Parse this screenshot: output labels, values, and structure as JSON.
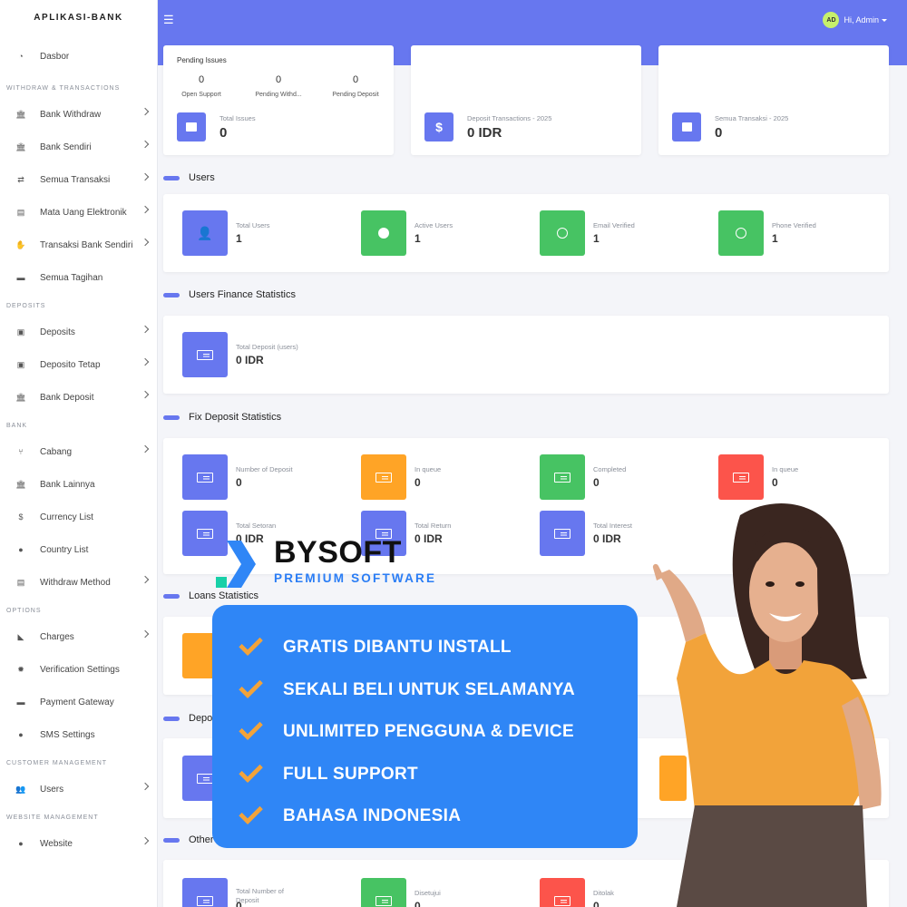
{
  "sidebar": {
    "brand": "APLIKASI-BANK",
    "dashboard": "Dasbor",
    "sections": {
      "withdraw": "WITHDRAW & TRANSACTIONS",
      "deposits": "DEPOSITS",
      "bank": "BANK",
      "options": "OPTIONS",
      "customer": "CUSTOMER MANAGEMENT",
      "website": "WEBSITE MANAGEMENT"
    },
    "items": {
      "bank_withdraw": "Bank Withdraw",
      "bank_sendiri": "Bank Sendiri",
      "semua_transaksi": "Semua Transaksi",
      "mata_uang": "Mata Uang Elektronik",
      "transaksi_bank": "Transaksi Bank Sendiri",
      "semua_tagihan": "Semua Tagihan",
      "deposits": "Deposits",
      "deposito_tetap": "Deposito Tetap",
      "bank_deposit": "Bank Deposit",
      "cabang": "Cabang",
      "bank_lainnya": "Bank Lainnya",
      "currency_list": "Currency List",
      "country_list": "Country List",
      "withdraw_method": "Withdraw Method",
      "charges": "Charges",
      "verification": "Verification Settings",
      "payment_gateway": "Payment Gateway",
      "sms": "SMS Settings",
      "users": "Users",
      "website": "Website"
    }
  },
  "topbar": {
    "avatar": "AD",
    "greeting": "Hi, Admin"
  },
  "pending": {
    "title": "Pending Issues",
    "open_support": {
      "value": "0",
      "label": "Open Support"
    },
    "pending_withdraw": {
      "value": "0",
      "label": "Pending Withd..."
    },
    "pending_deposit": {
      "value": "0",
      "label": "Pending Deposit"
    },
    "total": {
      "label": "Total Issues",
      "value": "0"
    }
  },
  "deposit_tx": {
    "label": "Deposit Transactions - 2025",
    "value": "0 IDR"
  },
  "semua_tx": {
    "label": "Semua Transaksi - 2025",
    "value": "0"
  },
  "sections": {
    "users": "Users",
    "finance": "Users Finance Statistics",
    "fix": "Fix Deposit Statistics",
    "loans": "Loans Statistics",
    "depo": "Depo",
    "other": "Other"
  },
  "users": {
    "total": {
      "label": "Total Users",
      "value": "1"
    },
    "active": {
      "label": "Active Users",
      "value": "1"
    },
    "email": {
      "label": "Email Verified",
      "value": "1"
    },
    "phone": {
      "label": "Phone Verified",
      "value": "1"
    }
  },
  "finance": {
    "total_deposit": {
      "label": "Total Deposit (users)",
      "value": "0 IDR"
    }
  },
  "fix": {
    "number": {
      "label": "Number of Deposit",
      "value": "0"
    },
    "queue1": {
      "label": "In queue",
      "value": "0"
    },
    "completed": {
      "label": "Completed",
      "value": "0"
    },
    "queue2": {
      "label": "In queue",
      "value": "0"
    },
    "setoran": {
      "label": "Total Setoran",
      "value": "0 IDR"
    },
    "return": {
      "label": "Total Return",
      "value": "0 IDR"
    },
    "interest": {
      "label": "Total Interest",
      "value": "0 IDR"
    }
  },
  "other": {
    "total_number": {
      "label": "Total Number of Deposit",
      "value": "0"
    },
    "disetujui": {
      "label": "Disetujui",
      "value": "0"
    },
    "ditolak": {
      "label": "Ditolak",
      "value": "0"
    }
  },
  "promo": {
    "logo": "BYSOFT",
    "tagline": "PREMIUM SOFTWARE",
    "items": [
      "GRATIS DIBANTU INSTALL",
      "SEKALI BELI UNTUK SELAMANYA",
      "UNLIMITED PENGGUNA & DEVICE",
      "FULL SUPPORT",
      "BAHASA INDONESIA"
    ]
  },
  "colors": {
    "primary": "#6777ef",
    "success": "#47c363",
    "warning": "#ffa426",
    "danger": "#fc544b",
    "promo": "#2f86f6"
  }
}
